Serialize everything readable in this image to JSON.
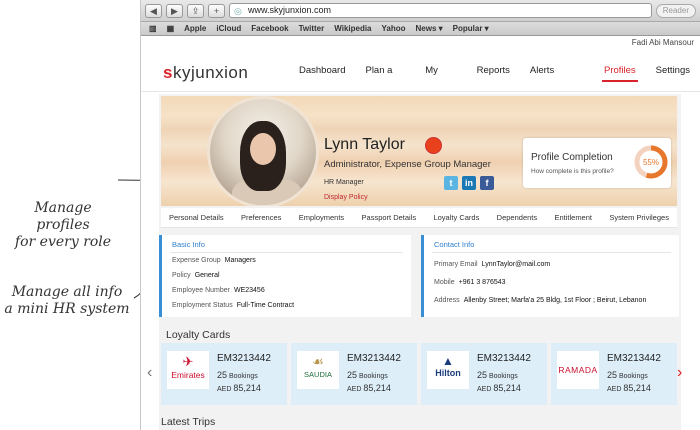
{
  "annotations": {
    "note1": [
      "Manage profiles",
      "for every role"
    ],
    "note2": [
      "Manage all info",
      "a mini HR system"
    ]
  },
  "browser": {
    "url": "www.skyjunxion.com",
    "reader": "Reader",
    "bookmarks": [
      "Apple",
      "iCloud",
      "Facebook",
      "Twitter",
      "Wikipedia",
      "Yahoo",
      "News ▾",
      "Popular ▾"
    ],
    "user": "Fadi Abi Mansour"
  },
  "app": {
    "logo_s": "s",
    "logo_rest": "kyjunxion",
    "menu": [
      "Dashboard",
      "Plan a Trip",
      "My Trips",
      "Reports",
      "Alerts Console",
      "Profiles",
      "Settings"
    ],
    "active_menu": "Profiles"
  },
  "profile": {
    "name": "Lynn Taylor",
    "role": "Administrator, Expense Group Manager",
    "hr": "HR Manager",
    "policy": "Display Policy",
    "completion_title": "Profile Completion",
    "completion_question": "How complete is this profile?",
    "completion_pct": "55%",
    "completion_value": 55,
    "accent": "#d8232a"
  },
  "tabs": [
    "Personal Details",
    "Preferences",
    "Employments",
    "Passport Details",
    "Loyalty Cards",
    "Dependents",
    "Entitlement",
    "System Privileges"
  ],
  "basic_info": {
    "title": "Basic Info",
    "rows": [
      {
        "label": "Expense Group",
        "value": "Managers"
      },
      {
        "label": "Policy",
        "value": "General"
      },
      {
        "label": "Employee Number",
        "value": "WE23456"
      },
      {
        "label": "Employment Status",
        "value": "Full-Time Contract"
      }
    ]
  },
  "contact_info": {
    "title": "Contact Info",
    "rows": [
      {
        "label": "Primary Email",
        "value": "LynnTaylor@mail.com"
      },
      {
        "label": "Mobile",
        "value": "+961 3 876543"
      },
      {
        "label": "Address",
        "value": "Allenby Street; Marfa'a 25 Bldg, 1st Floor ; Beirut, Lebanon"
      }
    ]
  },
  "loyalty": {
    "title": "Loyalty Cards",
    "cards": [
      {
        "brand": "Emirates",
        "number": "EM3213442",
        "bookings_num": "25",
        "bookings_label": "Bookings",
        "currency": "AED",
        "amount": "85,214"
      },
      {
        "brand": "SAUDIA",
        "number": "EM3213442",
        "bookings_num": "25",
        "bookings_label": "Bookings",
        "currency": "AED",
        "amount": "85,214"
      },
      {
        "brand": "Hilton",
        "number": "EM3213442",
        "bookings_num": "25",
        "bookings_label": "Bookings",
        "currency": "AED",
        "amount": "85,214"
      },
      {
        "brand": "RAMADA",
        "number": "EM3213442",
        "bookings_num": "25",
        "bookings_label": "Bookings",
        "currency": "AED",
        "amount": "85,214"
      }
    ]
  },
  "latest_trips": "Latest Trips"
}
